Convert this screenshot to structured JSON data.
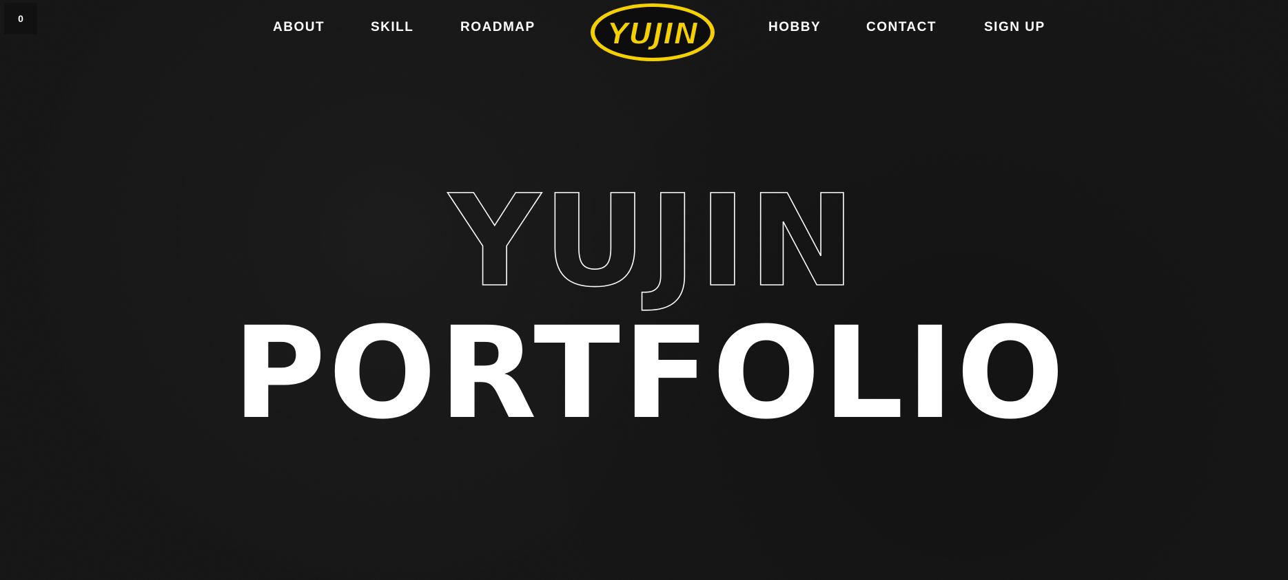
{
  "counter": {
    "value": "0"
  },
  "nav": {
    "left_items": [
      {
        "label": "ABOUT"
      },
      {
        "label": "SKILL"
      },
      {
        "label": "ROADMAP"
      }
    ],
    "right_items": [
      {
        "label": "HOBBY"
      },
      {
        "label": "CONTACT"
      },
      {
        "label": "SIGN UP"
      }
    ],
    "logo": {
      "text": "YUJIN"
    }
  },
  "hero": {
    "outline_title": "YUJIN",
    "main_title": "PORTFOLIO"
  },
  "colors": {
    "background": "#191919",
    "text": "#ffffff",
    "logo_fill": "#f5d000",
    "logo_dark": "#0d0d0d"
  }
}
